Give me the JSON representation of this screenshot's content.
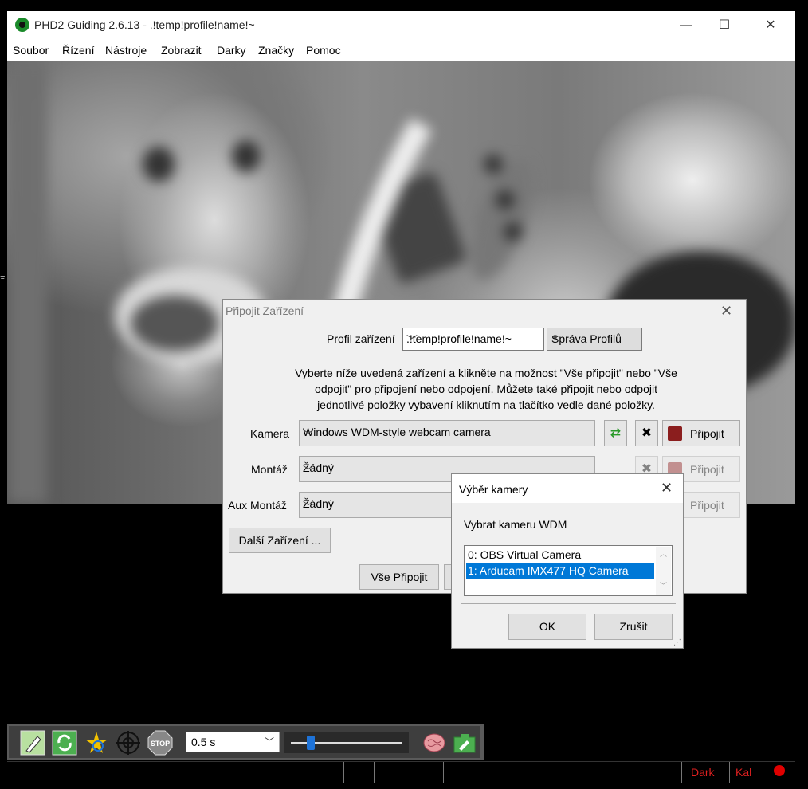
{
  "window": {
    "title": "PHD2 Guiding 2.6.13 - .!temp!profile!name!~",
    "minimize": "—",
    "maximize": "☐",
    "close": "✕"
  },
  "menu": [
    "Soubor",
    "Řízení",
    "Nástroje",
    "Zobrazit",
    "Darky",
    "Značky",
    "Pomoc"
  ],
  "toolbar": {
    "exposure": "0.5 s",
    "gamma_fraction": 0.18
  },
  "statusbar": {
    "dark": "Dark",
    "cal": "Kal"
  },
  "connect_dialog": {
    "title": "Připojit Zařízení",
    "close": "✕",
    "profile_label": "Profil zařízení",
    "profile_value": ".!temp!profile!name!~",
    "profile_manage": "Správa Profilů",
    "instructions_lines": [
      "Vyberte níže uvedená zařízení a klikněte na možnost \"Vše připojit\" nebo \"Vše",
      "odpojit\" pro připojení nebo odpojení. Můžete také připojit nebo odpojit",
      "jednotlivé položky vybavení kliknutím na tlačítko vedle dané položky."
    ],
    "devices": [
      {
        "label": "Kamera",
        "value": "Windows WDM-style webcam camera",
        "button": "Připojit"
      },
      {
        "label": "Montáž",
        "value": "Žádný",
        "button": "Připojit"
      },
      {
        "label": "Aux Montáž",
        "value": "Žádný",
        "button": "Připojit"
      }
    ],
    "more_devices": "Další Zařízení ...",
    "connect_all": "Vše Připojit"
  },
  "camera_dialog": {
    "title": "Výběr kamery",
    "close": "✕",
    "prompt": "Vybrat kameru WDM",
    "items": [
      "0: OBS Virtual Camera",
      "1: Arducam IMX477 HQ Camera"
    ],
    "selected_index": 1,
    "ok": "OK",
    "cancel": "Zrušit"
  }
}
